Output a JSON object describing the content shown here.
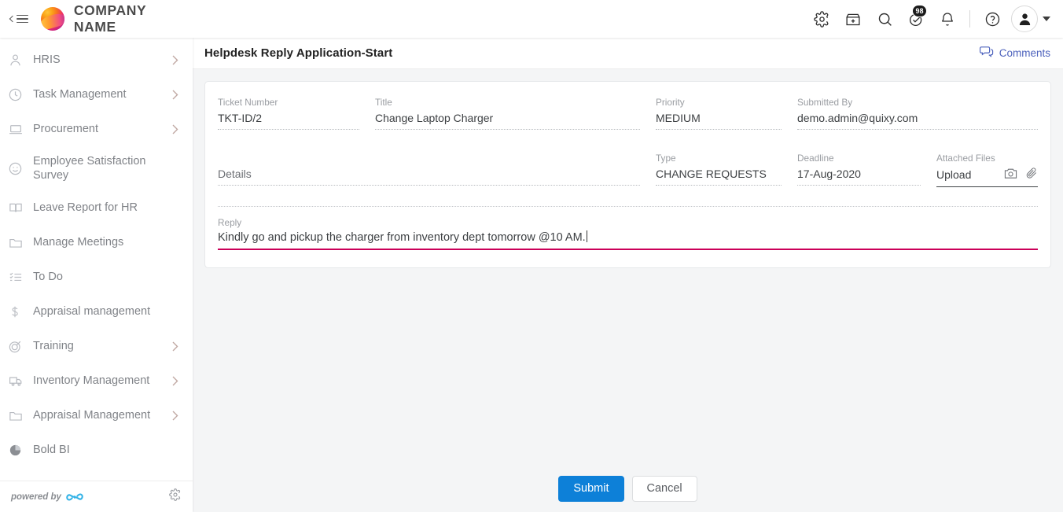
{
  "topbar": {
    "menu_toggle": "collapse-menu",
    "company_name": "COMPANY NAME",
    "icons": [
      {
        "name": "settings-icon",
        "label": "Settings"
      },
      {
        "name": "store-icon",
        "label": "App Store"
      },
      {
        "name": "search-icon",
        "label": "Search"
      },
      {
        "name": "tasks-icon",
        "label": "Tasks",
        "badge": "98"
      },
      {
        "name": "bell-icon",
        "label": "Notifications"
      },
      {
        "name": "help-icon",
        "label": "Help"
      }
    ],
    "notification_badge": "98",
    "avatar": "user-avatar"
  },
  "sidebar": {
    "items": [
      {
        "label": "HRIS",
        "icon": "user-icon",
        "chevron": true
      },
      {
        "label": "Task Management",
        "icon": "clock-icon",
        "chevron": true
      },
      {
        "label": "Procurement",
        "icon": "laptop-icon",
        "chevron": true
      },
      {
        "label": "Employee Satisfaction Survey",
        "icon": "smiley-icon",
        "chevron": false
      },
      {
        "label": "Leave Report for HR",
        "icon": "book-icon",
        "chevron": false
      },
      {
        "label": "Manage Meetings",
        "icon": "folder-icon",
        "chevron": false
      },
      {
        "label": "To Do",
        "icon": "checklist-icon",
        "chevron": false
      },
      {
        "label": "Appraisal management",
        "icon": "dollar-icon",
        "chevron": false
      },
      {
        "label": "Training",
        "icon": "target-icon",
        "chevron": true
      },
      {
        "label": "Inventory Management",
        "icon": "truck-icon",
        "chevron": true
      },
      {
        "label": "Appraisal Management",
        "icon": "folder-icon",
        "chevron": true
      },
      {
        "label": "Bold BI",
        "icon": "pie-chart-icon",
        "chevron": false
      }
    ],
    "footer": {
      "powered_by": "powered by",
      "brand_icon": "quixy-logo-icon",
      "settings_icon": "gear-icon"
    }
  },
  "main": {
    "title": "Helpdesk Reply Application-Start",
    "comments_label": "Comments",
    "comments_icon": "comments-icon",
    "form": {
      "ticket_number": {
        "label": "Ticket Number",
        "value": "TKT-ID/2"
      },
      "title": {
        "label": "Title",
        "value": "Change Laptop Charger"
      },
      "priority": {
        "label": "Priority",
        "value": "MEDIUM"
      },
      "submitted_by": {
        "label": "Submitted By",
        "value": "demo.admin@quixy.com"
      },
      "details": {
        "label": "Details",
        "value": ""
      },
      "type": {
        "label": "Type",
        "value": "CHANGE REQUESTS"
      },
      "deadline": {
        "label": "Deadline",
        "value": "17-Aug-2020"
      },
      "attached_files": {
        "label": "Attached Files",
        "value": "Upload",
        "camera_icon": "camera-icon",
        "attach_icon": "paperclip-icon"
      },
      "reply": {
        "label": "Reply",
        "value": "Kindly go and pickup the charger from inventory dept tomorrow @10 AM."
      }
    },
    "buttons": {
      "submit": "Submit",
      "cancel": "Cancel"
    }
  },
  "colors": {
    "accent_pink": "#cb0059",
    "primary_blue": "#0d80d8",
    "link_blue": "#4e63bd",
    "page_bg": "#f4f5f6"
  }
}
